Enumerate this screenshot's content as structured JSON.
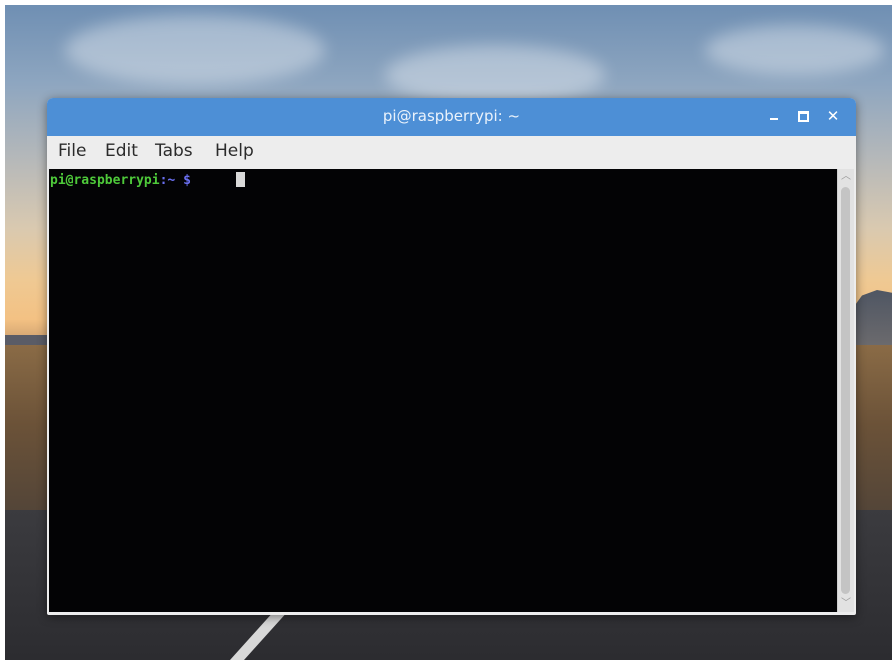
{
  "window": {
    "title": "pi@raspberrypi: ~",
    "controls": {
      "minimize_icon": "minimize-icon",
      "maximize_icon": "maximize-icon",
      "close_icon": "close-icon",
      "close_glyph": "✕"
    },
    "titlebar_color": "#4d8fd6"
  },
  "menubar": {
    "items": [
      {
        "label": "File"
      },
      {
        "label": "Edit"
      },
      {
        "label": "Tabs"
      },
      {
        "label": "Help"
      }
    ]
  },
  "terminal": {
    "prompt_user_host": "pi@raspberrypi",
    "prompt_separator": ":",
    "prompt_dir": "~",
    "prompt_symbol": "$",
    "background_color": "#030305",
    "prompt_user_color": "#4ec93a",
    "prompt_path_color": "#6a6ff0"
  },
  "scrollbar": {
    "up_icon": "chevron-up-icon",
    "down_icon": "chevron-down-icon",
    "up_glyph": "︿",
    "down_glyph": "﹀"
  },
  "desktop": {
    "wallpaper": "road-landscape-at-dusk"
  }
}
